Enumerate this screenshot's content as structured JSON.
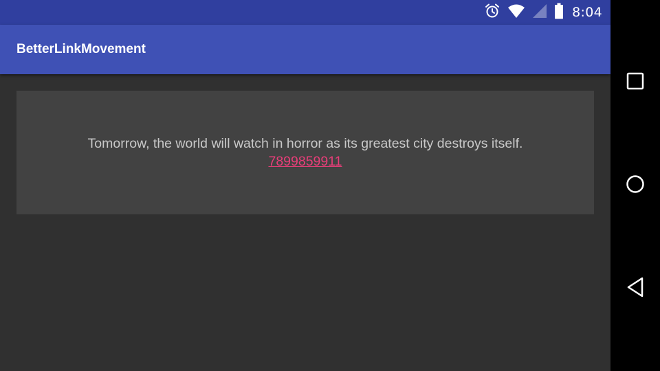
{
  "status_bar": {
    "time": "8:04",
    "icons": [
      "alarm-icon",
      "wifi-icon",
      "signal-icon",
      "battery-icon"
    ]
  },
  "app_bar": {
    "title": "BetterLinkMovement"
  },
  "card": {
    "text": "Tomorrow, the world will watch in horror as its greatest city destroys itself.",
    "link": "7899859911"
  },
  "nav_bar": {
    "buttons": [
      "recents-square-icon",
      "home-circle-icon",
      "back-triangle-icon"
    ]
  },
  "colors": {
    "status_bar": "#303F9F",
    "app_bar": "#3F51B5",
    "background": "#303030",
    "card": "#424242",
    "text": "#C8C8C8",
    "link": "#E83E79"
  }
}
